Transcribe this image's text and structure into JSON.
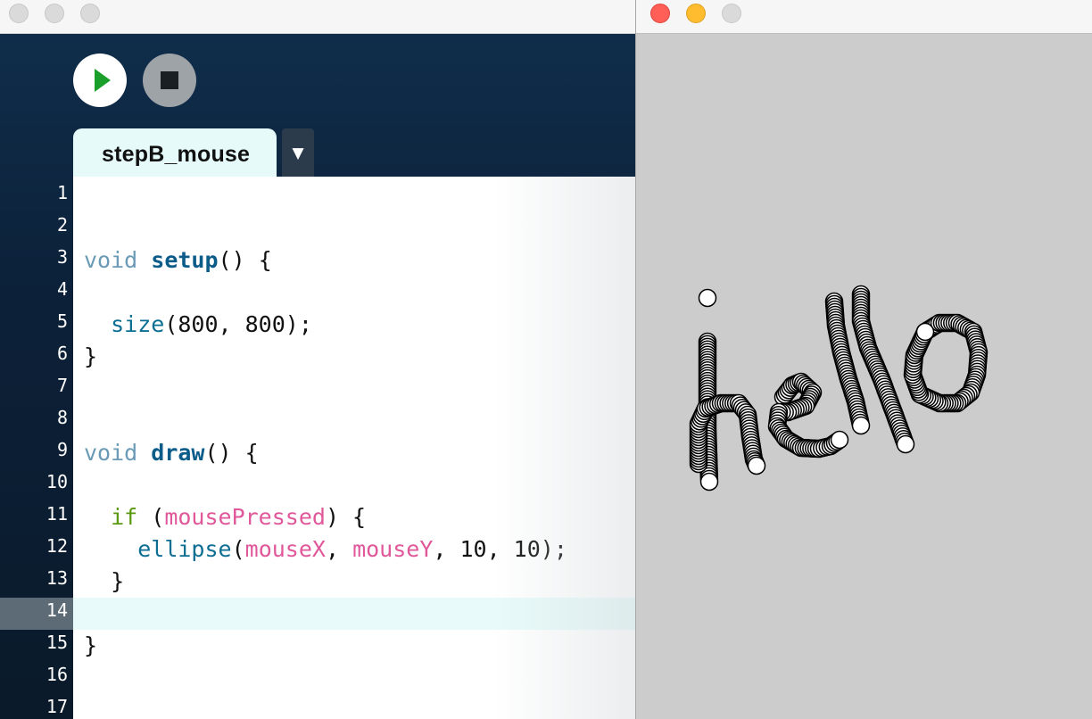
{
  "ide": {
    "sketch_tab": "stepB_mouse",
    "tab_menu_glyph": "▼",
    "toolbar": {
      "run_icon": "play-icon",
      "stop_icon": "stop-icon"
    },
    "current_line": 14,
    "line_numbers": [
      "1",
      "2",
      "3",
      "4",
      "5",
      "6",
      "7",
      "8",
      "9",
      "10",
      "11",
      "12",
      "13",
      "14",
      "15",
      "16",
      "17"
    ],
    "code": {
      "l3": {
        "kw": "void",
        "name": "setup",
        "rest": "() {"
      },
      "l5": {
        "call": "size",
        "rest": "(800, 800);"
      },
      "l6": {
        "text": "}"
      },
      "l9": {
        "kw": "void",
        "name": "draw",
        "rest": "() {"
      },
      "l11": {
        "kw": "if",
        "p1": " (",
        "var": "mousePressed",
        "p2": ") {"
      },
      "l12": {
        "call": "ellipse",
        "p1": "(",
        "v1": "mouseX",
        "p2": ", ",
        "v2": "mouseY",
        "p3": ", 10, 10);"
      },
      "l13": {
        "text": "}"
      },
      "l15": {
        "text": "}"
      }
    }
  },
  "sketch_window": {
    "background": "#cccccc",
    "ellipse_fill": "#ffffff",
    "ellipse_stroke": "#000000",
    "drawing": "hello"
  }
}
